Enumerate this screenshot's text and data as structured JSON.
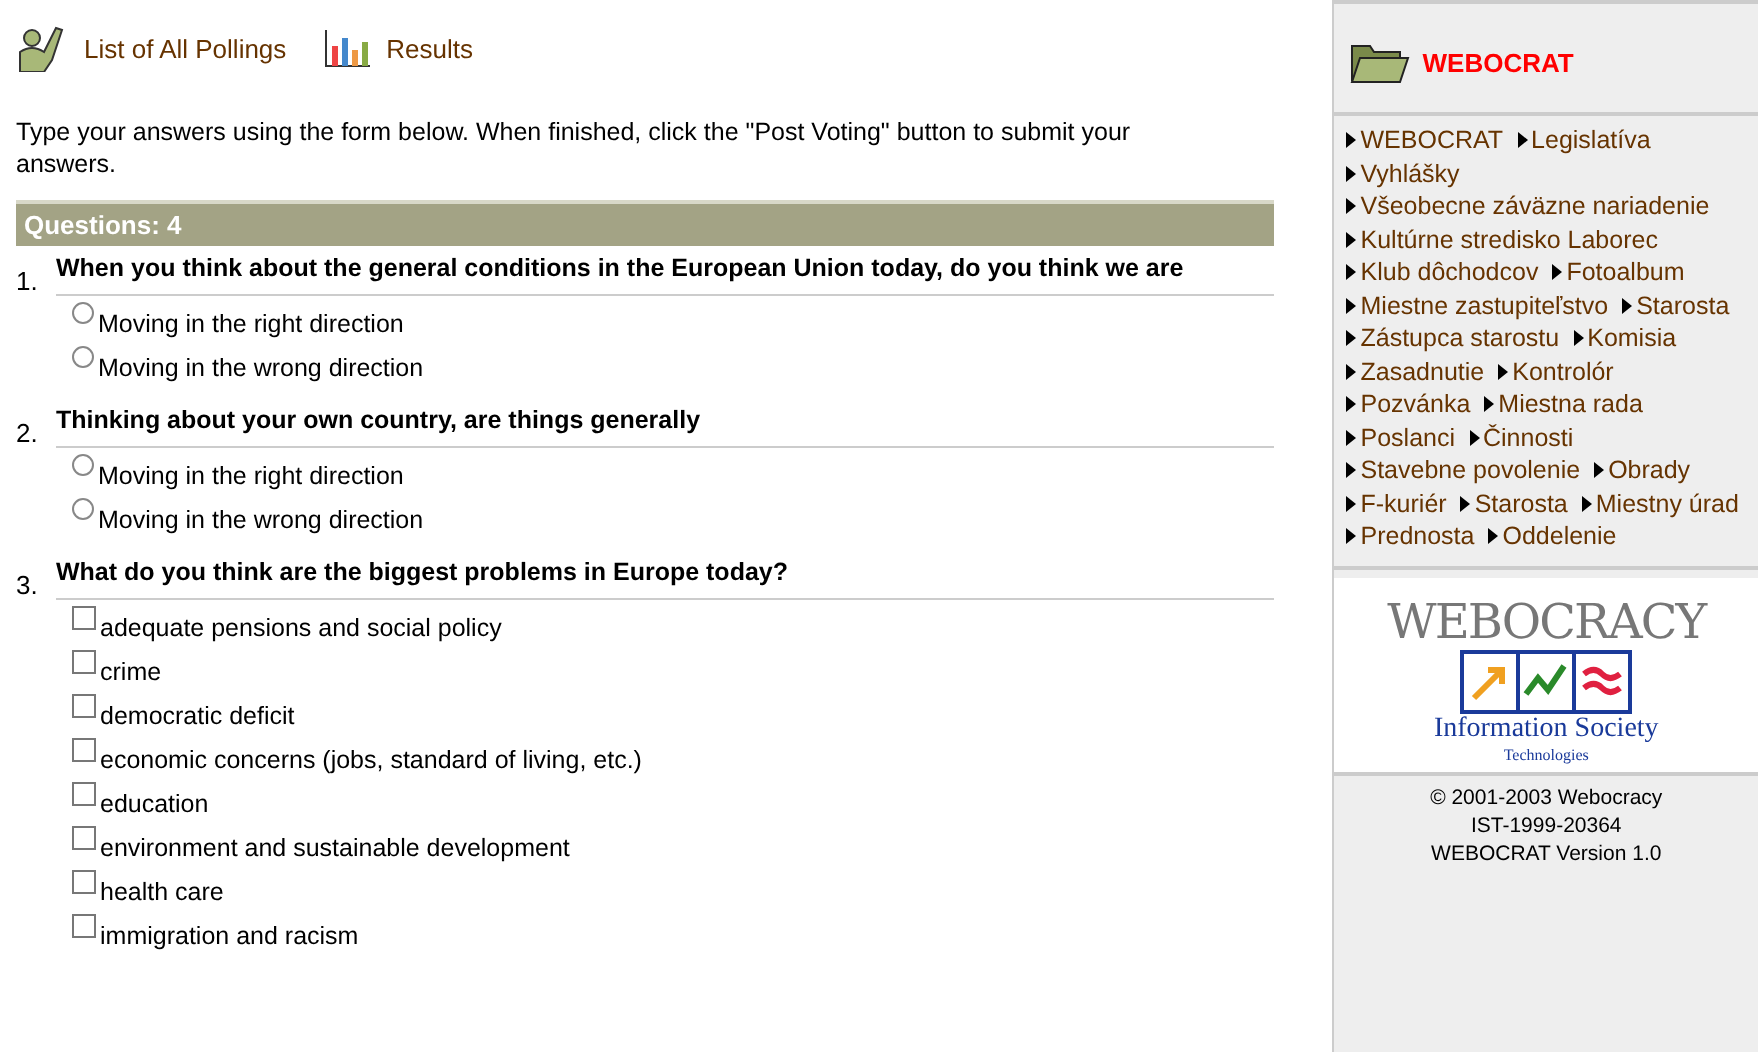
{
  "nav": [
    {
      "kind": "pollings",
      "label": "List of All Pollings"
    },
    {
      "kind": "results",
      "label": "Results"
    }
  ],
  "instructions": "Type your answers using the form below. When finished, click the \"Post Voting\" button to submit your answers.",
  "questions_header": "Questions: 4",
  "questions": [
    {
      "number": "1.",
      "text": "When you think about the general conditions in the European Union today, do you think we are",
      "kind": "radio",
      "options": [
        {
          "label": "Moving in the right direction",
          "selected": false
        },
        {
          "label": "Moving in the wrong direction",
          "selected": false
        }
      ]
    },
    {
      "number": "2.",
      "text": "Thinking about your own country, are things generally",
      "kind": "radio",
      "options": [
        {
          "label": "Moving in the right direction",
          "selected": false
        },
        {
          "label": "Moving in the wrong direction",
          "selected": false
        }
      ]
    },
    {
      "number": "3.",
      "text": "What do you think are the biggest problems in Europe today?",
      "kind": "checkbox",
      "options": [
        {
          "label": "adequate pensions and social policy",
          "checked": false
        },
        {
          "label": "crime",
          "checked": false
        },
        {
          "label": "democratic deficit",
          "checked": false
        },
        {
          "label": "economic concerns (jobs, standard of living, etc.)",
          "checked": false
        },
        {
          "label": "education",
          "checked": false
        },
        {
          "label": "environment and sustainable development",
          "checked": false
        },
        {
          "label": "health care",
          "checked": false
        },
        {
          "label": "immigration and racism",
          "checked": false
        }
      ]
    }
  ],
  "sidebar": {
    "title": "WEBOCRAT",
    "links": [
      "WEBOCRAT",
      "Legislatíva",
      "Vyhlášky",
      "Všeobecne záväzne nariadenie",
      "Kultúrne stredisko Laborec",
      "Klub dôchodcov",
      "Fotoalbum",
      "Miestne zastupiteľstvo",
      "Starosta",
      "Zástupca starostu",
      "Komisia",
      "Zasadnutie",
      "Kontrolór",
      "Pozvánka",
      "Miestna rada",
      "Poslanci",
      "Činnosti",
      "Stavebne povolenie",
      "Obrady",
      "F-kuriér",
      "Starosta",
      "Miestny úrad",
      "Prednosta",
      "Oddelenie"
    ],
    "logo_text": "WEBOCRACY",
    "ist_title": "Information Society",
    "ist_subtitle": "Technologies",
    "footer": [
      "© 2001-2003 Webocracy",
      "IST-1999-20364",
      "WEBOCRAT Version 1.0"
    ]
  }
}
